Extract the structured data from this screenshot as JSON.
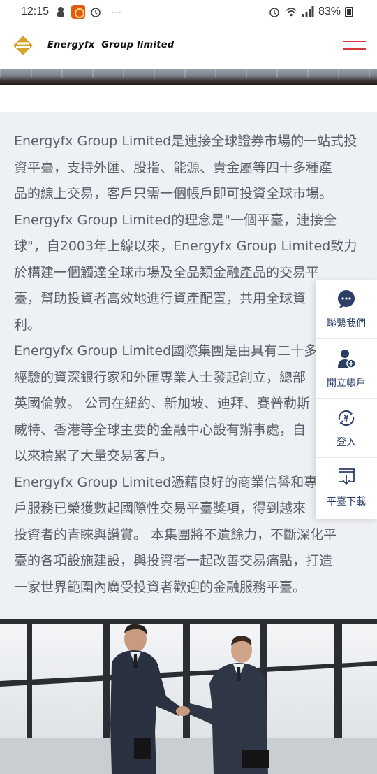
{
  "status_bar": {
    "time": "12:15",
    "battery": "83%",
    "dots": "···"
  },
  "header": {
    "brand_name": "Energyfx  Group limited",
    "logo_icon": "logo-icon",
    "menu_icon": "hamburger-menu-icon",
    "accent_color": "#d9363e"
  },
  "content": {
    "paragraphs": [
      [
        "Energyfx Group Limited是連接全球證券市場的一站式投",
        "資平臺，支持外匯、股指、能源、貴金屬等四十多種產",
        "品的線上交易，客戶只需一個帳戶即可投資全球市場。"
      ],
      [
        "Energyfx Group Limited的理念是\"一個平臺，連接全",
        "球\"，自2003年上線以來，Energyfx Group Limited致力",
        "於構建一個觸達全球市場及全品類金融產品的交易平",
        "臺，幫助投資者高效地進行資產配置，共用全球資",
        "利。"
      ],
      [
        "Energyfx Group Limited國際集團是由具有二十多",
        "經驗的資深銀行家和外匯專業人士發起創立，總部",
        "英國倫敦。 公司在紐約、新加坡、迪拜、賽普勒斯",
        "威特、香港等全球主要的金融中心設有辦事處，自",
        "以來積累了大量交易客戶。"
      ],
      [
        "Energyfx Group Limited憑藉良好的商業信譽和專",
        "戶服務已榮獲數起國際性交易平臺獎項，得到越來",
        "投資者的青睞與讚賞。 本集團將不遺餘力，不斷深化平",
        "臺的各項設施建設，與投資者一起改善交易痛點，打造",
        "一家世界範圍內廣受投資者歡迎的金融服務平臺。"
      ]
    ]
  },
  "side_panel": {
    "items": [
      {
        "label": "聯繫我們",
        "icon": "chat-icon"
      },
      {
        "label": "開立帳戶",
        "icon": "add-user-icon"
      },
      {
        "label": "登入",
        "icon": "money-login-icon"
      },
      {
        "label": "平臺下載",
        "icon": "download-icon"
      }
    ],
    "accent_color": "#2b3f66"
  }
}
